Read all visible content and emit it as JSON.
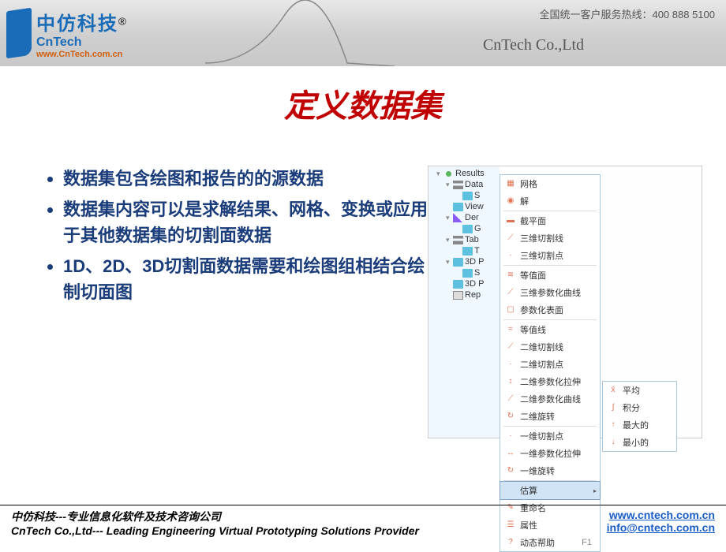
{
  "header": {
    "logo_cn": "中仿科技",
    "logo_reg": "®",
    "logo_sub": "CnTech",
    "logo_url": "www.CnTech.com.cn",
    "hotline": "全国统一客户服务热线：400 888 5100",
    "company": "CnTech Co.,Ltd"
  },
  "title": "定义数据集",
  "bullets": [
    "数据集包含绘图和报告的的源数据",
    "数据集内容可以是求解结果、网格、变换或应用于其他数据集的切割面数据",
    "1D、2D、3D切割面数据需要和绘图组相结合绘制切面图"
  ],
  "tree": [
    {
      "l": "l1",
      "t": "▾",
      "i": "ic-world",
      "label": "Results"
    },
    {
      "l": "l2",
      "t": "▾",
      "i": "ic-data",
      "label": "Data"
    },
    {
      "l": "l3",
      "t": "",
      "i": "ic-box",
      "label": "S"
    },
    {
      "l": "l2",
      "t": "",
      "i": "ic-box",
      "label": "View"
    },
    {
      "l": "l2",
      "t": "▾",
      "i": "ic-graph",
      "label": "Der"
    },
    {
      "l": "l3",
      "t": "",
      "i": "ic-box",
      "label": "G"
    },
    {
      "l": "l2",
      "t": "▾",
      "i": "ic-data",
      "label": "Tab"
    },
    {
      "l": "l3",
      "t": "",
      "i": "ic-box",
      "label": "T"
    },
    {
      "l": "l2",
      "t": "▾",
      "i": "ic-box",
      "label": "3D P"
    },
    {
      "l": "l3",
      "t": "",
      "i": "ic-box",
      "label": "S"
    },
    {
      "l": "l2",
      "t": "",
      "i": "ic-box",
      "label": "3D P"
    },
    {
      "l": "l2",
      "t": "",
      "i": "ic-rep",
      "label": "Rep"
    }
  ],
  "menu": [
    {
      "icon": "▦",
      "label": "网格"
    },
    {
      "icon": "◉",
      "label": "解"
    },
    {
      "sep": true
    },
    {
      "icon": "▬",
      "label": "截平面"
    },
    {
      "icon": "⟋",
      "label": "三维切割线"
    },
    {
      "icon": "·",
      "label": "三维切割点"
    },
    {
      "sep": true
    },
    {
      "icon": "≋",
      "label": "等值面"
    },
    {
      "icon": "⟋",
      "label": "三维参数化曲线"
    },
    {
      "icon": "▢",
      "label": "参数化表面"
    },
    {
      "sep": true
    },
    {
      "icon": "≈",
      "label": "等值线"
    },
    {
      "icon": "⟋",
      "label": "二维切割线"
    },
    {
      "icon": "·",
      "label": "二维切割点"
    },
    {
      "icon": "↕",
      "label": "二维参数化拉伸"
    },
    {
      "icon": "⟋",
      "label": "二维参数化曲线"
    },
    {
      "icon": "↻",
      "label": "二维旋转"
    },
    {
      "sep": true
    },
    {
      "icon": "·",
      "label": "一维切割点"
    },
    {
      "icon": "↔",
      "label": "一维参数化拉伸"
    },
    {
      "icon": "↻",
      "label": "一维旋转"
    },
    {
      "sep": true
    },
    {
      "icon": "",
      "label": "估算",
      "arrow": "▸",
      "hl": true
    },
    {
      "icon": "✎",
      "label": "重命名"
    },
    {
      "icon": "☰",
      "label": "属性"
    },
    {
      "icon": "?",
      "label": "动态帮助",
      "key": "F1"
    }
  ],
  "submenu": [
    {
      "icon": "x̄",
      "label": "平均"
    },
    {
      "icon": "∫",
      "label": "积分"
    },
    {
      "icon": "↑",
      "label": "最大的"
    },
    {
      "icon": "↓",
      "label": "最小的"
    }
  ],
  "footer": {
    "line1": "中仿科技---专业信息化软件及技术咨询公司",
    "line2": "CnTech Co.,Ltd--- Leading Engineering Virtual Prototyping Solutions Provider",
    "url": "www.cntech.com.cn",
    "email": "info@cntech.com.cn"
  }
}
